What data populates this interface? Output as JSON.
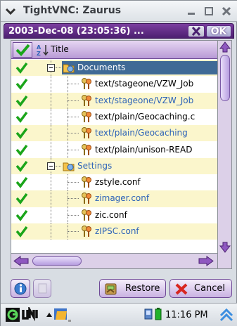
{
  "window": {
    "title": "TightVNC: Zaurus"
  },
  "dialog": {
    "title": "2003-Dec-08 (23:05:36) ...",
    "ok_label": "OK"
  },
  "list": {
    "header_title": "Title",
    "rows": [
      {
        "label": "Documents",
        "type": "folder",
        "selected": true,
        "checked": true
      },
      {
        "label": "text/stageone/VZW_Job",
        "type": "file",
        "color": "black",
        "checked": true
      },
      {
        "label": "text/stageone/VZW_Job",
        "type": "file",
        "color": "blue",
        "checked": true
      },
      {
        "label": "text/plain/Geocaching.c",
        "type": "file",
        "color": "black",
        "checked": true
      },
      {
        "label": "text/plain/Geocaching",
        "type": "file",
        "color": "blue",
        "checked": true
      },
      {
        "label": "text/plain/unison-READ",
        "type": "file",
        "color": "black",
        "checked": true
      },
      {
        "label": "Settings",
        "type": "folder",
        "color": "blue",
        "checked": true
      },
      {
        "label": "zstyle.conf",
        "type": "file",
        "color": "black",
        "checked": true
      },
      {
        "label": "zimager.conf",
        "type": "file",
        "color": "blue",
        "checked": true
      },
      {
        "label": "zic.conf",
        "type": "file",
        "color": "black",
        "checked": true
      },
      {
        "label": "zIPSC.conf",
        "type": "file",
        "color": "blue",
        "checked": true
      }
    ]
  },
  "toolbar": {
    "restore_label": "Restore",
    "cancel_label": "Cancel"
  },
  "taskbar": {
    "clock": "11:16 PM"
  },
  "colors": {
    "accent_purple": "#5a2a80",
    "selection_blue": "#3f6a96",
    "check_green": "#1aa51a",
    "odd_row": "#fbf6cc"
  }
}
